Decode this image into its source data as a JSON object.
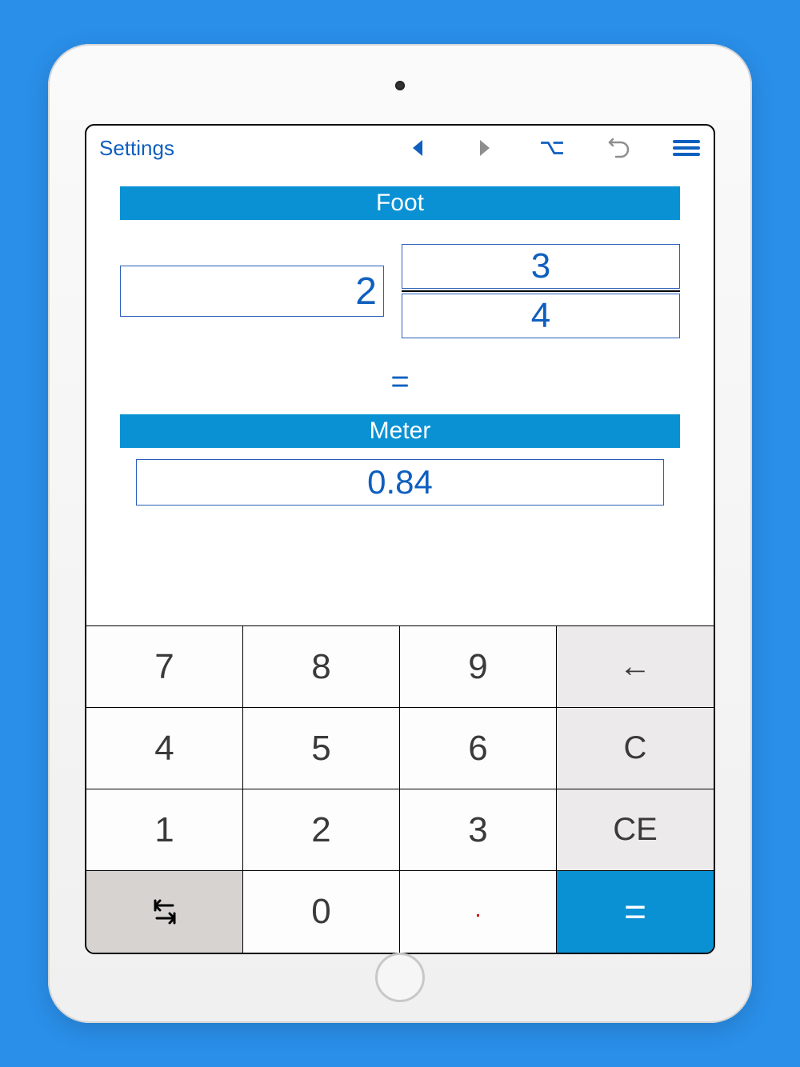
{
  "toolbar": {
    "settings_label": "Settings"
  },
  "conversion": {
    "from_unit": "Foot",
    "to_unit": "Meter",
    "whole_value": "2",
    "numerator": "3",
    "denominator": "4",
    "equals": "=",
    "result": "0.84"
  },
  "keypad": {
    "k7": "7",
    "k8": "8",
    "k9": "9",
    "k4": "4",
    "k5": "5",
    "k6": "6",
    "k1": "1",
    "k2": "2",
    "k3": "3",
    "k0": "0",
    "backspace": "←",
    "clear": "C",
    "clear_entry": "CE",
    "decimal": ".",
    "equals": "="
  },
  "colors": {
    "accent": "#0a91d4",
    "link": "#0f5fbf",
    "background": "#2a8fe9"
  }
}
